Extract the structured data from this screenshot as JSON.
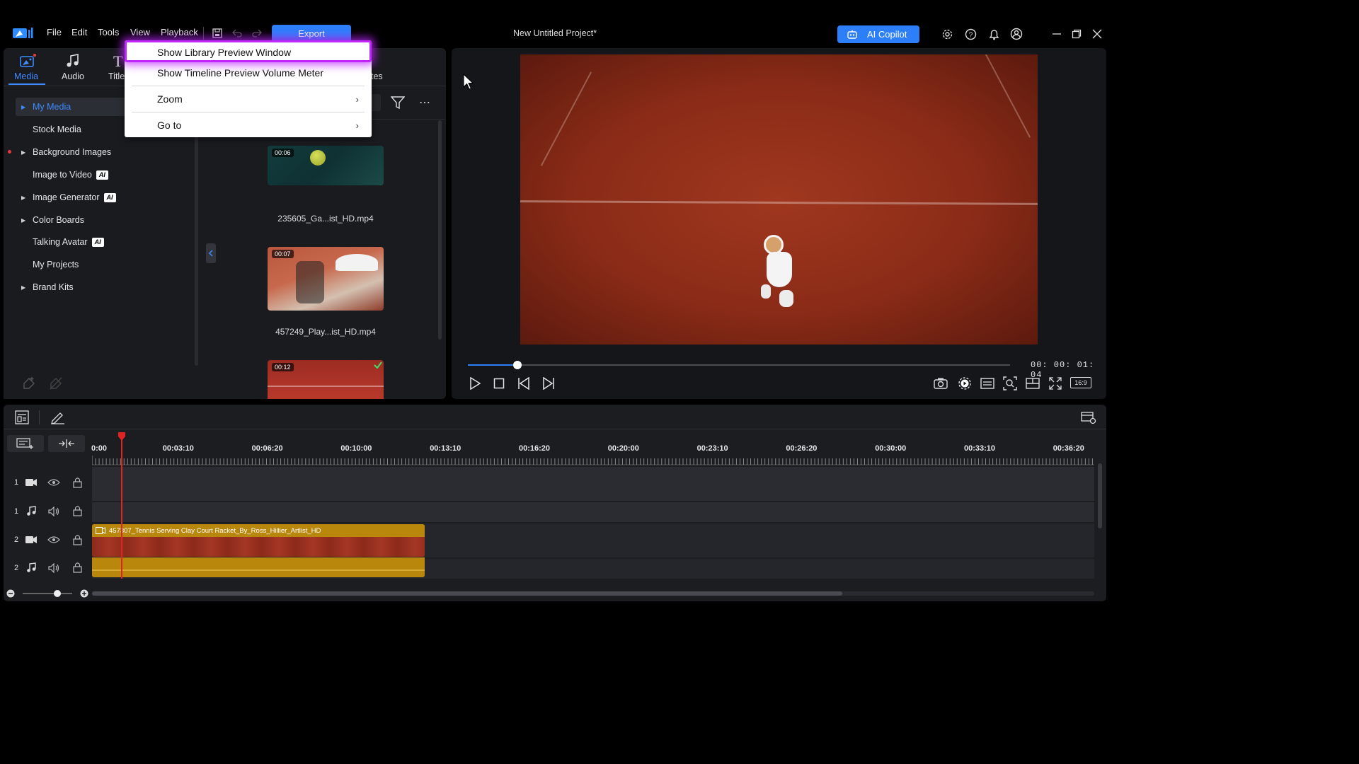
{
  "menu": {
    "file": "File",
    "edit": "Edit",
    "tools": "Tools",
    "view": "View",
    "playback": "Playback"
  },
  "export_label": "Export",
  "project_title": "New Untitled Project*",
  "copilot_label": "AI Copilot",
  "library_tabs": [
    {
      "label": "Media"
    },
    {
      "label": "Audio"
    },
    {
      "label": "Title"
    }
  ],
  "hidden_tab_fragment": "tes",
  "sidebar": {
    "items": [
      {
        "label": "My Media",
        "arrow": true,
        "active": true
      },
      {
        "label": "Stock Media",
        "arrow": false
      },
      {
        "label": "Background Images",
        "arrow": true
      },
      {
        "label": "Image to Video",
        "arrow": false,
        "ai": "AI"
      },
      {
        "label": "Image Generator",
        "arrow": true,
        "ai": "AI"
      },
      {
        "label": "Color Boards",
        "arrow": true
      },
      {
        "label": "Talking Avatar",
        "arrow": false,
        "ai": "AI"
      },
      {
        "label": "My Projects",
        "arrow": false
      },
      {
        "label": "Brand Kits",
        "arrow": true
      }
    ]
  },
  "media": [
    {
      "duration": "00:06",
      "name": "235605_Ga...ist_HD.mp4"
    },
    {
      "duration": "00:07",
      "name": "457249_Play...ist_HD.mp4"
    },
    {
      "duration": "00:12",
      "name": ""
    }
  ],
  "context_menu": {
    "items": [
      {
        "label": "Show Library Preview Window",
        "submenu": false,
        "highlighted": true
      },
      {
        "label": "Show Timeline Preview Volume Meter",
        "submenu": false
      },
      {
        "label": "Zoom",
        "submenu": true
      },
      {
        "label": "Go to",
        "submenu": true
      }
    ]
  },
  "preview": {
    "timecode": "00: 00: 01: 04",
    "aspect": "16:9",
    "progress": 0.091
  },
  "timeline": {
    "ticks": [
      "0:00",
      "00:03:10",
      "00:06:20",
      "00:10:00",
      "00:13:10",
      "00:16:20",
      "00:20:00",
      "00:23:10",
      "00:26:20",
      "00:30:00",
      "00:33:10",
      "00:36:20"
    ],
    "tracks": [
      {
        "num": "1",
        "type": "video"
      },
      {
        "num": "1",
        "type": "audio"
      },
      {
        "num": "2",
        "type": "video"
      },
      {
        "num": "2",
        "type": "audio"
      }
    ],
    "clip_name": "457307_Tennis Serving Clay Court Racket_By_Ross_Hillier_Artlist_HD"
  },
  "colors": {
    "accent": "#2d7ff9",
    "clip": "#b8870c",
    "highlight": "#c026ff",
    "playhead": "#e02424"
  }
}
